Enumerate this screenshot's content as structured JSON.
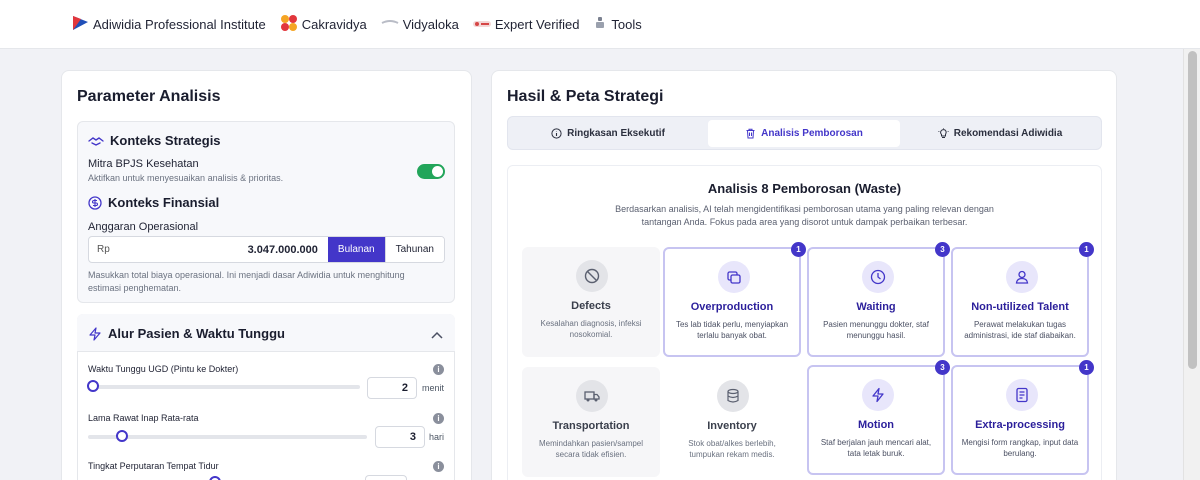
{
  "nav": {
    "items": [
      {
        "label": "Adiwidia Professional Institute",
        "icon": "adiwidia-logo-icon"
      },
      {
        "label": "Cakravidya",
        "icon": "cakravidya-logo-icon"
      },
      {
        "label": "Vidyaloka",
        "icon": "vidyaloka-logo-icon"
      },
      {
        "label": "Expert Verified",
        "icon": "expert-verified-logo-icon"
      },
      {
        "label": "Tools",
        "icon": "tools-icon"
      }
    ]
  },
  "left": {
    "title": "Parameter Analisis",
    "strategic": {
      "heading": "Konteks Strategis",
      "bpjs_label": "Mitra BPJS Kesehatan",
      "bpjs_sub": "Aktifkan untuk menyesuaikan analisis & prioritas.",
      "bpjs_on": true
    },
    "financial": {
      "heading": "Konteks Finansial",
      "budget_label": "Anggaran Operasional",
      "currency": "Rp",
      "value": "3.047.000.000",
      "period_monthly": "Bulanan",
      "period_yearly": "Tahunan",
      "selected_period": "Bulanan",
      "help": "Masukkan total biaya operasional. Ini menjadi dasar Adiwidia untuk menghitung estimasi penghematan."
    },
    "flow": {
      "heading": "Alur Pasien & Waktu Tunggu",
      "params": [
        {
          "label": "Waktu Tunggu UGD (Pintu ke Dokter)",
          "value": "2",
          "unit": "menit"
        },
        {
          "label": "Lama Rawat Inap Rata-rata",
          "value": "3",
          "unit": "hari"
        },
        {
          "label": "Tingkat Perputaran Tempat Tidur",
          "value": "",
          "unit": ""
        }
      ]
    }
  },
  "right": {
    "title": "Hasil & Peta Strategi",
    "tabs": [
      {
        "label": "Ringkasan Eksekutif",
        "icon": "info-circle-icon"
      },
      {
        "label": "Analisis Pemborosan",
        "icon": "trash-icon"
      },
      {
        "label": "Rekomendasi Adiwidia",
        "icon": "lightbulb-icon"
      }
    ],
    "active_tab": "Analisis Pemborosan",
    "waste": {
      "title": "Analisis 8 Pemborosan (Waste)",
      "description": "Berdasarkan analisis, AI telah mengidentifikasi pemborosan utama yang paling relevan dengan tantangan Anda. Fokus pada area yang disorot untuk dampak perbaikan terbesar.",
      "cards": [
        {
          "name": "Defects",
          "desc": "Kesalahan diagnosis, infeksi nosokomial.",
          "badge": "",
          "icon": "ban-icon"
        },
        {
          "name": "Overproduction",
          "desc": "Tes lab tidak perlu, menyiapkan terlalu banyak obat.",
          "badge": "1",
          "icon": "copy-stack-icon"
        },
        {
          "name": "Waiting",
          "desc": "Pasien menunggu dokter, staf menunggu hasil.",
          "badge": "3",
          "icon": "clock-icon"
        },
        {
          "name": "Non-utilized Talent",
          "desc": "Perawat melakukan tugas administrasi, ide staf diabaikan.",
          "badge": "1",
          "icon": "user-icon"
        },
        {
          "name": "Transportation",
          "desc": "Memindahkan pasien/sampel secara tidak efisien.",
          "badge": "",
          "icon": "truck-icon"
        },
        {
          "name": "Inventory",
          "desc": "Stok obat/alkes berlebih, tumpukan rekam medis.",
          "badge": "",
          "icon": "database-icon"
        },
        {
          "name": "Motion",
          "desc": "Staf berjalan jauh mencari alat, tata letak buruk.",
          "badge": "3",
          "icon": "lightning-icon"
        },
        {
          "name": "Extra-processing",
          "desc": "Mengisi form rangkap, input data berulang.",
          "badge": "1",
          "icon": "document-icon"
        }
      ]
    }
  }
}
